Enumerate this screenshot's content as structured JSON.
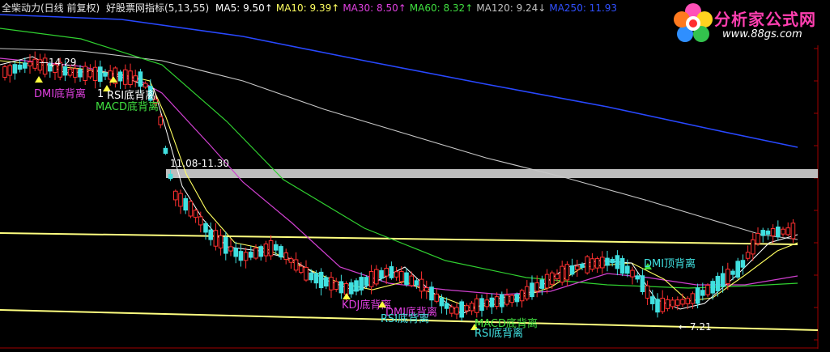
{
  "legend": {
    "stock": "全柴动力(日线 前复权)",
    "indicator": "好股票网指标(5,13,55)",
    "ma": [
      {
        "label": "MA5:",
        "value": "9.50",
        "color": "#ffffff"
      },
      {
        "label": "MA10:",
        "value": "9.39",
        "color": "#ffff60"
      },
      {
        "label": "MA30:",
        "value": "8.50",
        "color": "#e040e0"
      },
      {
        "label": "MA60:",
        "value": "8.32",
        "color": "#40e040"
      },
      {
        "label": "MA120:",
        "value": "9.24",
        "color": "#c0c0c0"
      },
      {
        "label": "MA250:",
        "value": "11.93",
        "color": "#3050ff"
      }
    ]
  },
  "logo": {
    "site": "分析家公式网",
    "url": "www.88gs.com"
  },
  "chart_data": {
    "type": "candlestick",
    "ylim": [
      6.8,
      16.0
    ],
    "annotations": {
      "high_price": "14.29",
      "gap_label": "11.08-11.30",
      "low_price": "7.21"
    },
    "signals": [
      {
        "text": "DMI底背离",
        "color": "#e040e0"
      },
      {
        "text": "1",
        "color": "#ffffff"
      },
      {
        "text": "RSI底背离",
        "color": "#ffffff"
      },
      {
        "text": "MACD底背离",
        "color": "#40e040"
      },
      {
        "text": "KDJ底背离",
        "color": "#e040e0"
      },
      {
        "text": "DMI底背离",
        "color": "#e040e0"
      },
      {
        "text": "RSI底背离",
        "color": "#40e0e0"
      },
      {
        "text": "MACD底背离",
        "color": "#40e040"
      },
      {
        "text": "RSI底背离",
        "color": "#40e0e0"
      },
      {
        "text": "DMI顶背离",
        "color": "#40e0e0"
      }
    ],
    "colors": {
      "up": "#ff3030",
      "down": "#40e0e0",
      "trendline": "#ffff80",
      "gap_band": "#bdbdbd"
    }
  }
}
